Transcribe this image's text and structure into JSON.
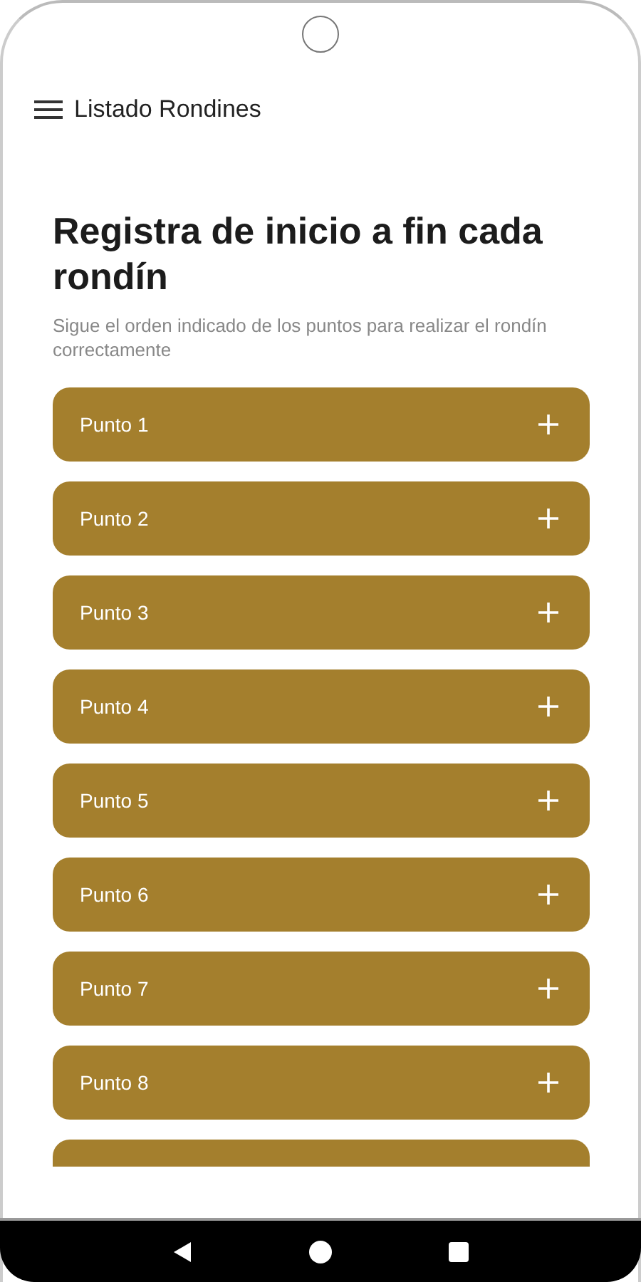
{
  "app_bar": {
    "title": "Listado Rondines"
  },
  "heading": "Registra de inicio a fin cada rondín",
  "subtitle": "Sigue el orden indicado de los puntos para realizar el rondín correctamente",
  "points": [
    {
      "label": "Punto 1",
      "expanded": false
    },
    {
      "label": "Punto 2",
      "expanded": false
    },
    {
      "label": "Punto 3",
      "expanded": false
    },
    {
      "label": "Punto 4",
      "expanded": false
    },
    {
      "label": "Punto 5",
      "expanded": false
    },
    {
      "label": "Punto 6",
      "expanded": false
    },
    {
      "label": "Punto 7",
      "expanded": false
    },
    {
      "label": "Punto 8",
      "expanded": false
    }
  ]
}
